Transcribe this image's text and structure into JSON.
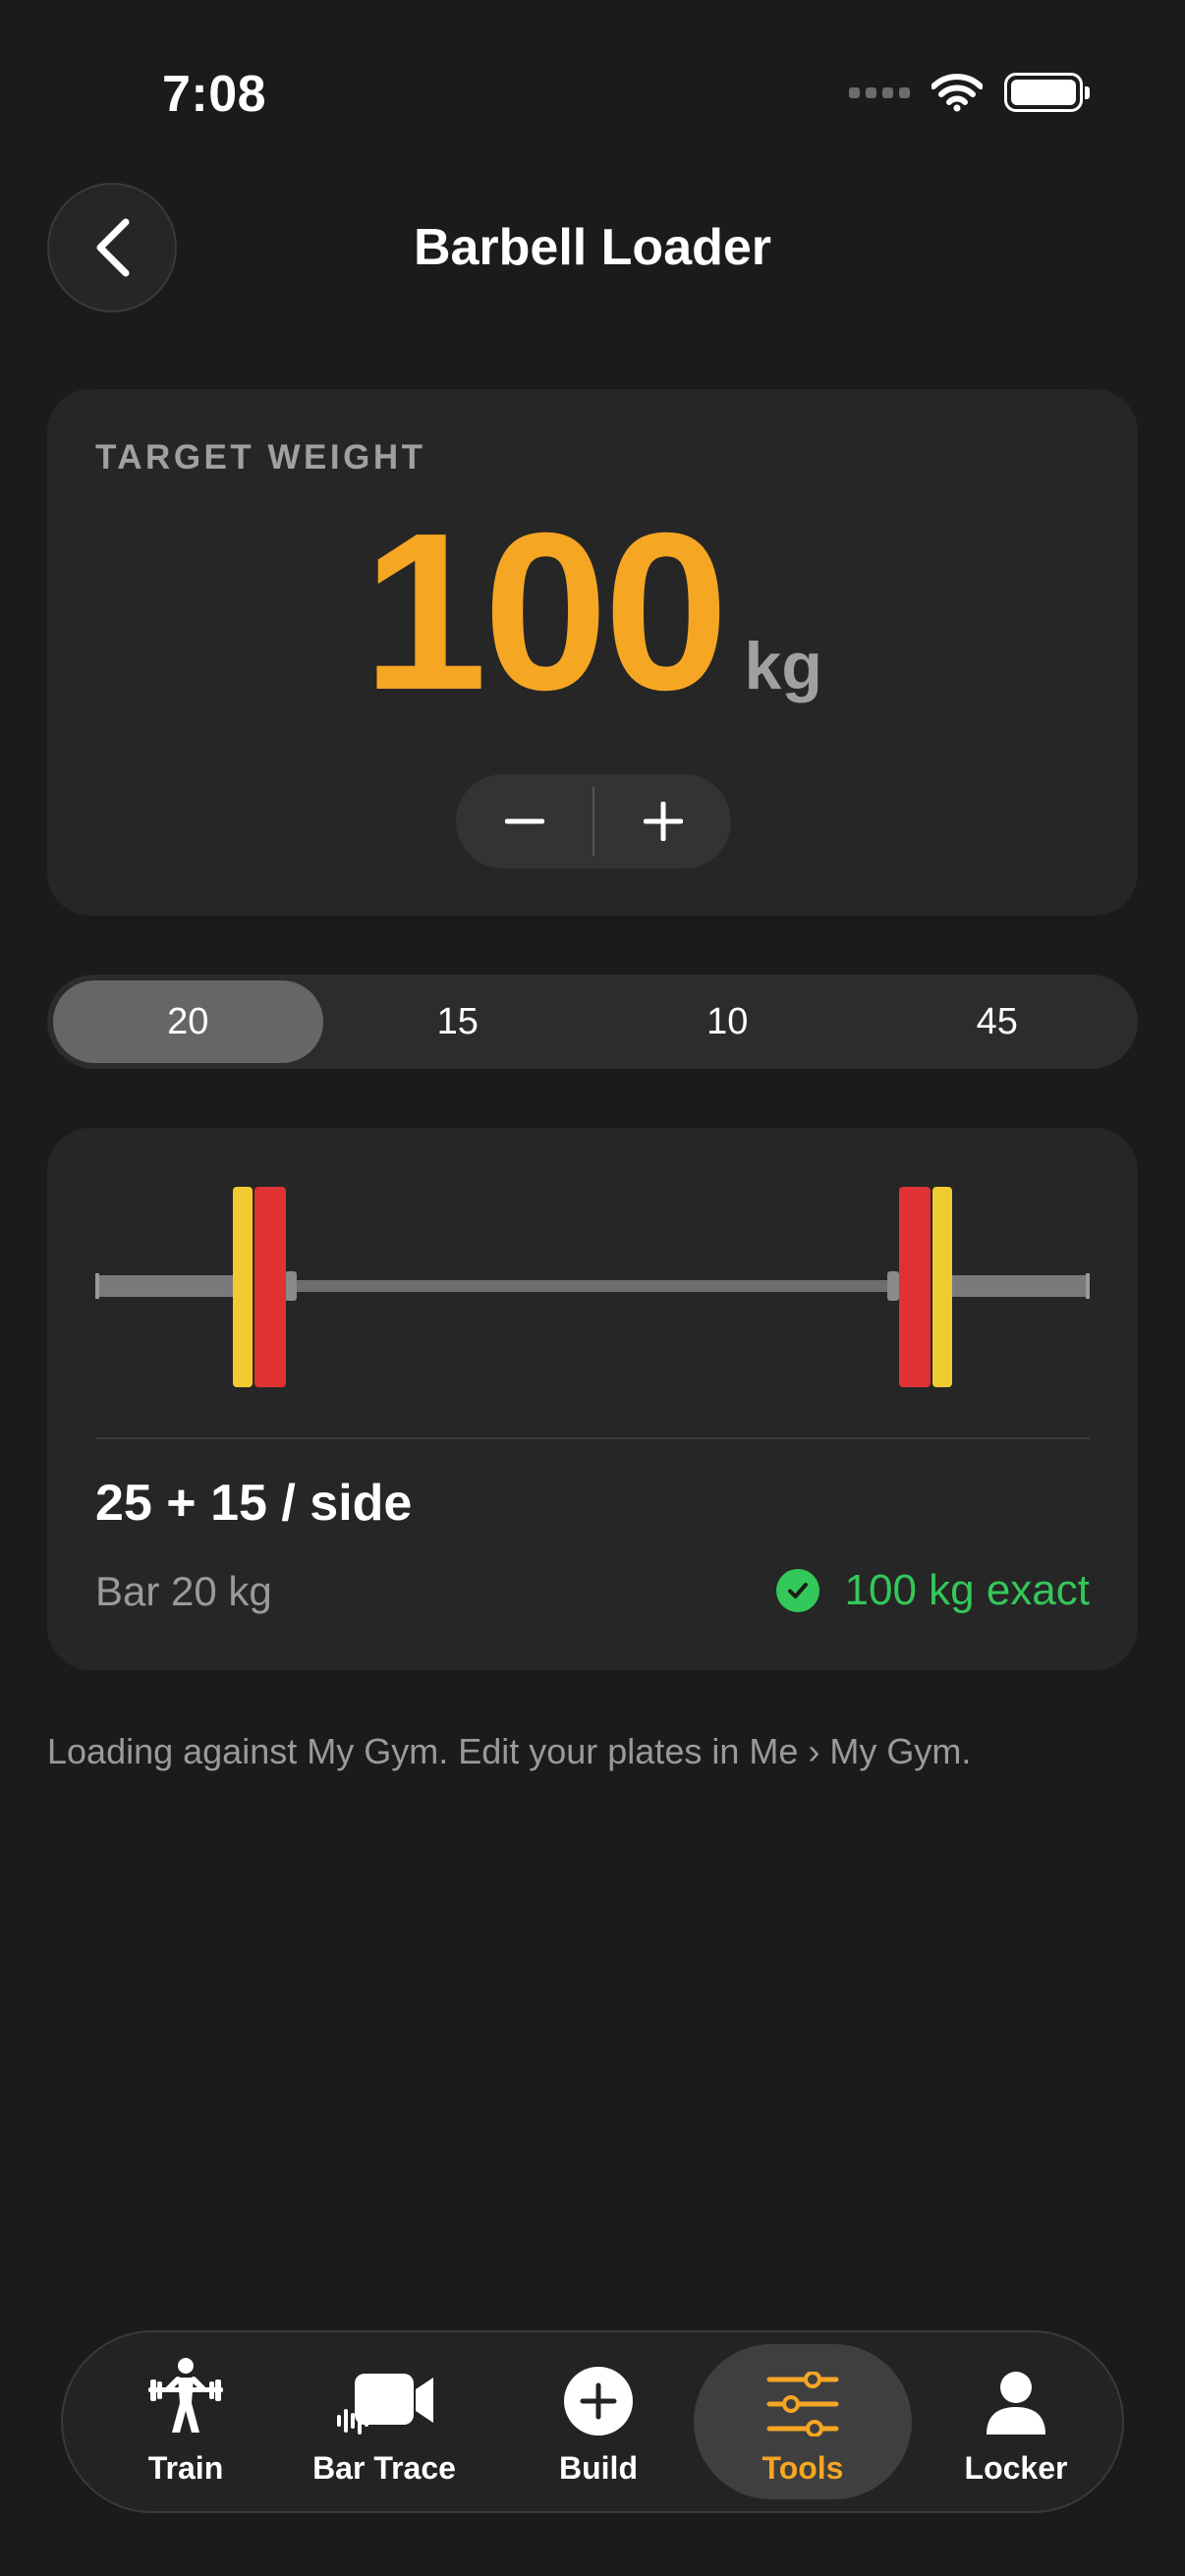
{
  "status_bar": {
    "time": "7:08"
  },
  "header": {
    "title": "Barbell Loader"
  },
  "target": {
    "label": "TARGET WEIGHT",
    "value": "100",
    "unit": "kg"
  },
  "bar_options": {
    "items": [
      "20",
      "15",
      "10",
      "45"
    ],
    "selected": "20"
  },
  "loadout": {
    "per_side": "25 + 15 / side",
    "bar": "Bar 20 kg",
    "result": "100 kg exact",
    "plates_per_side_kg": [
      25,
      15
    ],
    "plate_colors": {
      "25": "#e03232",
      "15": "#f0cc30"
    }
  },
  "footnote": "Loading against My Gym. Edit your plates in Me › My Gym.",
  "tabbar": {
    "items": [
      {
        "label": "Train",
        "icon": "lifter-icon"
      },
      {
        "label": "Bar Trace",
        "icon": "video-camera-icon"
      },
      {
        "label": "Build",
        "icon": "plus-circle-icon"
      },
      {
        "label": "Tools",
        "icon": "sliders-icon"
      },
      {
        "label": "Locker",
        "icon": "person-icon"
      }
    ],
    "active": "Tools"
  },
  "colors": {
    "accent": "#f5a623",
    "success": "#34c759",
    "background": "#1b1b1b",
    "card": "#262626"
  }
}
